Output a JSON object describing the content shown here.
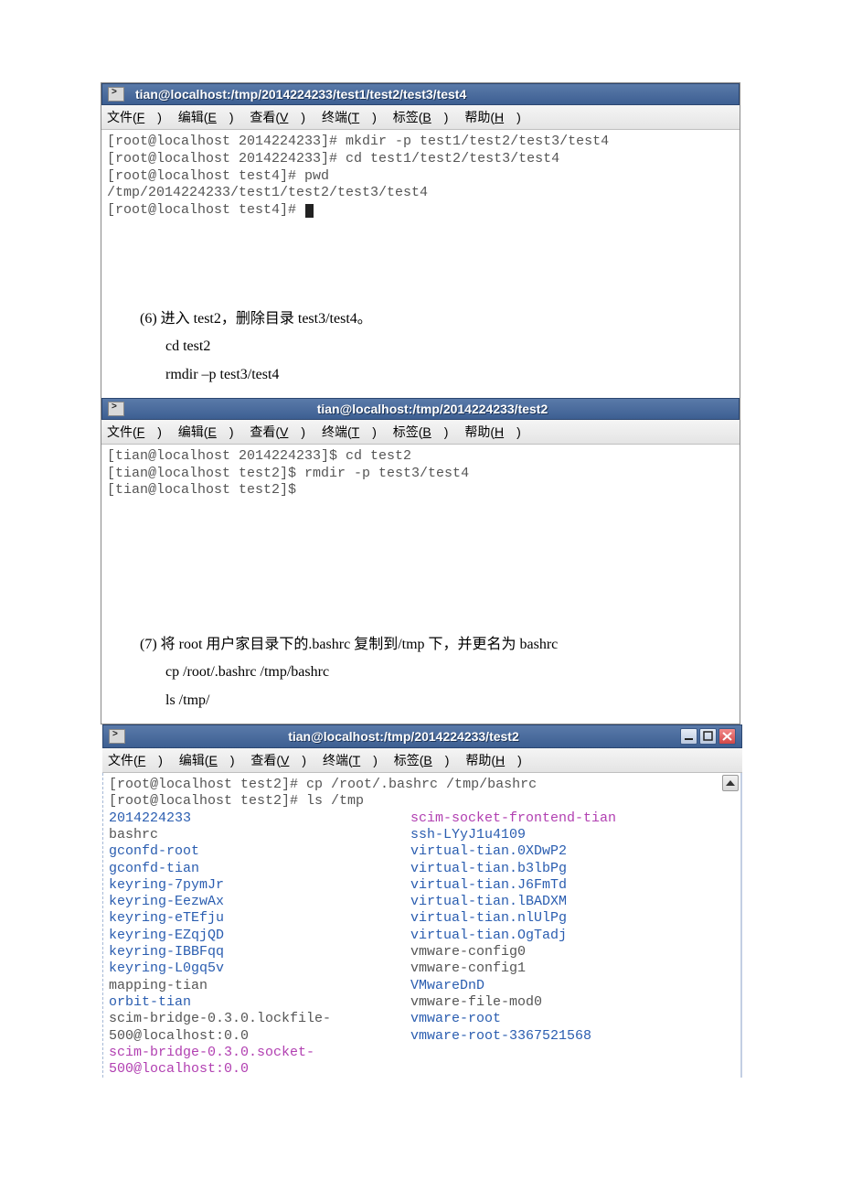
{
  "menus": {
    "file": "文件(F)",
    "edit": "编辑(E)",
    "view": "查看(V)",
    "terminal": "终端(T)",
    "tabs": "标签(B)",
    "help": "帮助(H)"
  },
  "win1": {
    "title": "tian@localhost:/tmp/2014224233/test1/test2/test3/test4",
    "lines": [
      "[root@localhost 2014224233]# mkdir -p test1/test2/test3/test4",
      "[root@localhost 2014224233]# cd test1/test2/test3/test4",
      "[root@localhost test4]# pwd",
      "/tmp/2014224233/test1/test2/test3/test4",
      "[root@localhost test4]# "
    ]
  },
  "doc1": {
    "l1": "(6) 进入 test2，删除目录 test3/test4。",
    "l2": "cd test2",
    "l3": "rmdir –p test3/test4"
  },
  "win2": {
    "title": "tian@localhost:/tmp/2014224233/test2",
    "lines": [
      "[tian@localhost 2014224233]$ cd test2",
      "[tian@localhost test2]$ rmdir -p test3/test4",
      "[tian@localhost test2]$"
    ]
  },
  "doc2": {
    "l1": "(7) 将 root 用户家目录下的.bashrc 复制到/tmp 下，并更名为 bashrc",
    "l2": "cp   /root/.bashrc   /tmp/bashrc",
    "l3": "ls   /tmp/"
  },
  "win3": {
    "title": "tian@localhost:/tmp/2014224233/test2",
    "head": [
      "[root@localhost test2]# cp /root/.bashrc /tmp/bashrc",
      "[root@localhost test2]# ls /tmp"
    ],
    "col1": [
      {
        "t": "2014224233",
        "c": "dir"
      },
      {
        "t": "bashrc",
        "c": "reg"
      },
      {
        "t": "gconfd-root",
        "c": "dir"
      },
      {
        "t": "gconfd-tian",
        "c": "dir"
      },
      {
        "t": "keyring-7pymJr",
        "c": "dir"
      },
      {
        "t": "keyring-EezwAx",
        "c": "dir"
      },
      {
        "t": "keyring-eTEfju",
        "c": "dir"
      },
      {
        "t": "keyring-EZqjQD",
        "c": "dir"
      },
      {
        "t": "keyring-IBBFqq",
        "c": "dir"
      },
      {
        "t": "keyring-L0gq5v",
        "c": "dir"
      },
      {
        "t": "mapping-tian",
        "c": "reg"
      },
      {
        "t": "orbit-tian",
        "c": "dir"
      },
      {
        "t": "scim-bridge-0.3.0.lockfile-500@localhost:0.0",
        "c": "reg"
      },
      {
        "t": "scim-bridge-0.3.0.socket-500@localhost:0.0",
        "c": "sock"
      }
    ],
    "col2": [
      {
        "t": "scim-socket-frontend-tian",
        "c": "sock"
      },
      {
        "t": "ssh-LYyJ1u4109",
        "c": "dir"
      },
      {
        "t": "virtual-tian.0XDwP2",
        "c": "dir"
      },
      {
        "t": "virtual-tian.b3lbPg",
        "c": "dir"
      },
      {
        "t": "virtual-tian.J6FmTd",
        "c": "dir"
      },
      {
        "t": "virtual-tian.lBADXM",
        "c": "dir"
      },
      {
        "t": "virtual-tian.nlUlPg",
        "c": "dir"
      },
      {
        "t": "virtual-tian.OgTadj",
        "c": "dir"
      },
      {
        "t": "vmware-config0",
        "c": "reg"
      },
      {
        "t": "vmware-config1",
        "c": "reg"
      },
      {
        "t": "VMwareDnD",
        "c": "dir"
      },
      {
        "t": "vmware-file-mod0",
        "c": "reg"
      },
      {
        "t": "vmware-root",
        "c": "dir"
      },
      {
        "t": "vmware-root-3367521568",
        "c": "dir"
      }
    ]
  }
}
